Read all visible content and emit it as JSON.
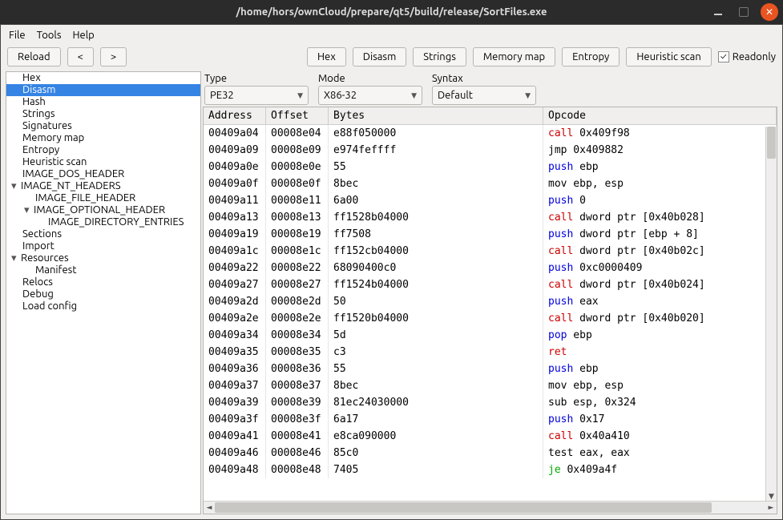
{
  "window": {
    "title": "/home/hors/ownCloud/prepare/qt5/build/release/SortFiles.exe"
  },
  "menubar": [
    "File",
    "Tools",
    "Help"
  ],
  "toolbar": {
    "reload": "Reload",
    "back": "<",
    "fwd": ">",
    "hex": "Hex",
    "disasm": "Disasm",
    "strings": "Strings",
    "memmap": "Memory map",
    "entropy": "Entropy",
    "heuristic": "Heuristic scan",
    "readonly_label": "Readonly",
    "readonly_checked": "✓"
  },
  "sidebar": [
    {
      "label": "Hex",
      "level": 0
    },
    {
      "label": "Disasm",
      "level": 0,
      "selected": true
    },
    {
      "label": "Hash",
      "level": 0
    },
    {
      "label": "Strings",
      "level": 0
    },
    {
      "label": "Signatures",
      "level": 0
    },
    {
      "label": "Memory map",
      "level": 0
    },
    {
      "label": "Entropy",
      "level": 0
    },
    {
      "label": "Heuristic scan",
      "level": 0
    },
    {
      "label": "IMAGE_DOS_HEADER",
      "level": 0
    },
    {
      "label": "IMAGE_NT_HEADERS",
      "level": 0,
      "arrow": "▾"
    },
    {
      "label": "IMAGE_FILE_HEADER",
      "level": 1
    },
    {
      "label": "IMAGE_OPTIONAL_HEADER",
      "level": 1,
      "arrow": "▾"
    },
    {
      "label": "IMAGE_DIRECTORY_ENTRIES",
      "level": 2
    },
    {
      "label": "Sections",
      "level": 0
    },
    {
      "label": "Import",
      "level": 0
    },
    {
      "label": "Resources",
      "level": 0,
      "arrow": "▾"
    },
    {
      "label": "Manifest",
      "level": 1
    },
    {
      "label": "Relocs",
      "level": 0
    },
    {
      "label": "Debug",
      "level": 0
    },
    {
      "label": "Load config",
      "level": 0
    }
  ],
  "combos": {
    "type": {
      "label": "Type",
      "value": "PE32"
    },
    "mode": {
      "label": "Mode",
      "value": "X86-32"
    },
    "syntax": {
      "label": "Syntax",
      "value": "Default"
    }
  },
  "table": {
    "headers": {
      "address": "Address",
      "offset": "Offset",
      "bytes": "Bytes",
      "opcode": "Opcode"
    },
    "rows": [
      {
        "address": "00409a04",
        "offset": "00008e04",
        "bytes": "e88f050000",
        "mn": "call",
        "args": "0x409f98"
      },
      {
        "address": "00409a09",
        "offset": "00008e09",
        "bytes": "e974feffff",
        "mn": "jmp",
        "args": "0x409882"
      },
      {
        "address": "00409a0e",
        "offset": "00008e0e",
        "bytes": "55",
        "mn": "push",
        "args": "ebp"
      },
      {
        "address": "00409a0f",
        "offset": "00008e0f",
        "bytes": "8bec",
        "mn": "mov",
        "args": "ebp, esp"
      },
      {
        "address": "00409a11",
        "offset": "00008e11",
        "bytes": "6a00",
        "mn": "push",
        "args": "0"
      },
      {
        "address": "00409a13",
        "offset": "00008e13",
        "bytes": "ff1528b04000",
        "mn": "call",
        "args": "dword ptr [0x40b028]"
      },
      {
        "address": "00409a19",
        "offset": "00008e19",
        "bytes": "ff7508",
        "mn": "push",
        "args": "dword ptr [ebp + 8]"
      },
      {
        "address": "00409a1c",
        "offset": "00008e1c",
        "bytes": "ff152cb04000",
        "mn": "call",
        "args": "dword ptr [0x40b02c]"
      },
      {
        "address": "00409a22",
        "offset": "00008e22",
        "bytes": "68090400c0",
        "mn": "push",
        "args": "0xc0000409"
      },
      {
        "address": "00409a27",
        "offset": "00008e27",
        "bytes": "ff1524b04000",
        "mn": "call",
        "args": "dword ptr [0x40b024]"
      },
      {
        "address": "00409a2d",
        "offset": "00008e2d",
        "bytes": "50",
        "mn": "push",
        "args": "eax"
      },
      {
        "address": "00409a2e",
        "offset": "00008e2e",
        "bytes": "ff1520b04000",
        "mn": "call",
        "args": "dword ptr [0x40b020]"
      },
      {
        "address": "00409a34",
        "offset": "00008e34",
        "bytes": "5d",
        "mn": "pop",
        "args": "ebp"
      },
      {
        "address": "00409a35",
        "offset": "00008e35",
        "bytes": "c3",
        "mn": "ret",
        "args": ""
      },
      {
        "address": "00409a36",
        "offset": "00008e36",
        "bytes": "55",
        "mn": "push",
        "args": "ebp"
      },
      {
        "address": "00409a37",
        "offset": "00008e37",
        "bytes": "8bec",
        "mn": "mov",
        "args": "ebp, esp"
      },
      {
        "address": "00409a39",
        "offset": "00008e39",
        "bytes": "81ec24030000",
        "mn": "sub",
        "args": "esp, 0x324"
      },
      {
        "address": "00409a3f",
        "offset": "00008e3f",
        "bytes": "6a17",
        "mn": "push",
        "args": "0x17"
      },
      {
        "address": "00409a41",
        "offset": "00008e41",
        "bytes": "e8ca090000",
        "mn": "call",
        "args": "0x40a410"
      },
      {
        "address": "00409a46",
        "offset": "00008e46",
        "bytes": "85c0",
        "mn": "test",
        "args": "eax, eax"
      },
      {
        "address": "00409a48",
        "offset": "00008e48",
        "bytes": "7405",
        "mn": "je",
        "args": "0x409a4f"
      }
    ]
  }
}
